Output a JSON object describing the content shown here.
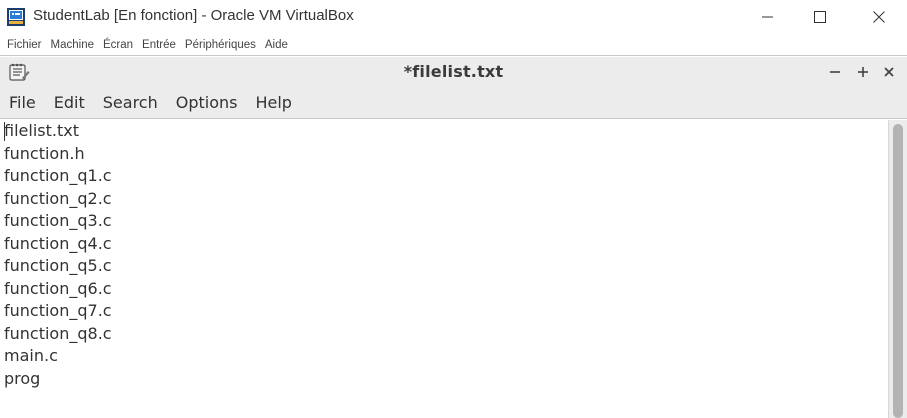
{
  "host": {
    "title": "StudentLab [En fonction] - Oracle VM VirtualBox",
    "menu": [
      "Fichier",
      "Machine",
      "Écran",
      "Entrée",
      "Périphériques",
      "Aide"
    ]
  },
  "guest": {
    "title": "*filelist.txt",
    "menu": [
      "File",
      "Edit",
      "Search",
      "Options",
      "Help"
    ],
    "lines": [
      "filelist.txt",
      "function.h",
      "function_q1.c",
      "function_q2.c",
      "function_q3.c",
      "function_q4.c",
      "function_q5.c",
      "function_q6.c",
      "function_q7.c",
      "function_q8.c",
      "main.c",
      "prog"
    ]
  },
  "icons": {
    "host_app": "virtualbox-icon",
    "guest_app": "text-editor-icon",
    "host_controls": [
      "minimize-icon",
      "maximize-icon",
      "close-icon"
    ],
    "guest_controls": [
      "minimize-icon",
      "maximize-icon",
      "close-icon"
    ]
  },
  "colors": {
    "text": "#333333",
    "chrome": "#ececec",
    "scroll_thumb": "#b3b3b3"
  }
}
